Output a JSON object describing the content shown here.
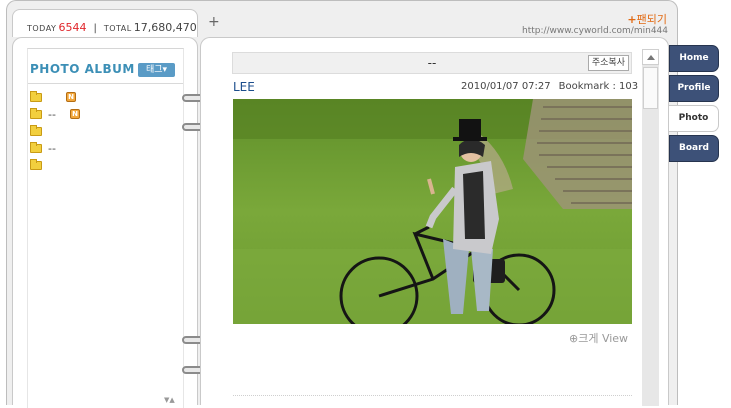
{
  "counter": {
    "today_label": "TODAY",
    "today_value": "6544",
    "total_label": "TOTAL",
    "total_value": "17,680,470"
  },
  "new_tab_label": "+",
  "header": {
    "fandom_prefix": "+",
    "fandom_label": "팬되기",
    "url": "http://www.cyworld.com/min444"
  },
  "album": {
    "title": "PHOTO ALBUM",
    "tag_button": "태그▾",
    "folders": [
      {
        "name": "",
        "new_badge": "N"
      },
      {
        "name": "--",
        "new_badge": "N"
      },
      {
        "name": "",
        "new_badge": ""
      },
      {
        "name": "--",
        "new_badge": ""
      },
      {
        "name": "",
        "new_badge": ""
      }
    ],
    "sort_arrows": "▼▲"
  },
  "post": {
    "title": "--",
    "copy_address_button": "주소복사",
    "author": "LEE",
    "date": "2010/01/07 07:27",
    "bookmark": "Bookmark : 103",
    "view_link": "크게 View"
  },
  "nav": {
    "tabs": [
      "Home",
      "Profile",
      "Photo",
      "Board"
    ],
    "active": "Photo"
  },
  "colors": {
    "today_red": "#e0262b",
    "album_blue": "#3c8fb6",
    "nav_tab": "#3d5178",
    "fandom_orange": "#e26a13"
  },
  "icons": {
    "folder": "folder-icon",
    "new_badge": "new-badge-icon",
    "zoom": "magnifier-icon",
    "scroll_up": "arrow-up-icon"
  }
}
